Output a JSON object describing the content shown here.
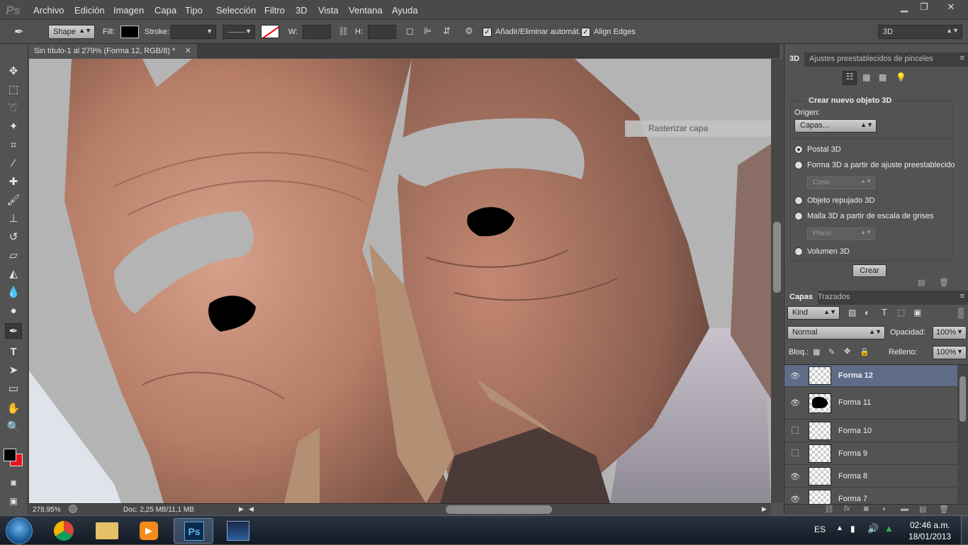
{
  "app": {
    "logo": "Ps"
  },
  "menu": [
    "Archivo",
    "Edición",
    "Imagen",
    "Capa",
    "Tipo",
    "Selección",
    "Filtro",
    "3D",
    "Vista",
    "Ventana",
    "Ayuda"
  ],
  "window_controls": {
    "minimize": "▁",
    "restore": "❐",
    "close": "✕"
  },
  "options": {
    "mode_value": "Shape",
    "fill_label": "Fill:",
    "stroke_label": "Stroke:",
    "w_label": "W:",
    "h_label": "H:",
    "auto_add_delete_label": "Añadir/Eliminar automát.",
    "align_edges_label": "Align Edges",
    "workspace_value": "3D"
  },
  "document": {
    "tab_title": "Sin título-1 al 279% (Forma 12, RGB/8) *"
  },
  "tooltip": "Rasterizar capa",
  "status": {
    "zoom": "278,95%",
    "doc": "Doc: 2,25 MB/11,1 MB"
  },
  "panel3d": {
    "tabs": [
      "3D",
      "Ajustes preestablecidos de pinceles"
    ],
    "section_title": "Crear nuevo objeto 3D",
    "origin_label": "Origen:",
    "origin_value": "Capas...",
    "options": [
      "Postal 3D",
      "Forma 3D a partir de ajuste preestablecido",
      "Objeto repujado 3D",
      "Malla 3D a partir de escala de grises",
      "Volumen 3D"
    ],
    "preset_value": "Cono",
    "grayscale_value": "Plano",
    "create_button": "Crear"
  },
  "layers": {
    "tabs": [
      "Capas",
      "Trazados"
    ],
    "kind_value": "Kind",
    "blend_value": "Normal",
    "opacity_label": "Opacidad:",
    "opacity_value": "100%",
    "lock_label": "Bloq.:",
    "fill_label": "Relleno:",
    "fill_value": "100%",
    "items": [
      {
        "name": "Forma 12",
        "visible": true,
        "selected": true
      },
      {
        "name": "Forma 11",
        "visible": true,
        "selected": false
      },
      {
        "name": "Forma 10",
        "visible": false,
        "selected": false
      },
      {
        "name": "Forma 9",
        "visible": false,
        "selected": false
      },
      {
        "name": "Forma 8",
        "visible": true,
        "selected": false
      },
      {
        "name": "Forma 7",
        "visible": true,
        "selected": false
      }
    ]
  },
  "taskbar": {
    "apps": [
      "chrome-icon",
      "explorer-icon",
      "media-player-icon",
      "photoshop-icon",
      "image-viewer-icon"
    ],
    "ps_label": "Ps",
    "lang": "ES",
    "time": "02:46 a.m.",
    "date": "18/01/2013"
  },
  "colors": {
    "accent_selected_layer": "#5f6c88",
    "foreground": "#000000",
    "background": "#e8141c"
  }
}
